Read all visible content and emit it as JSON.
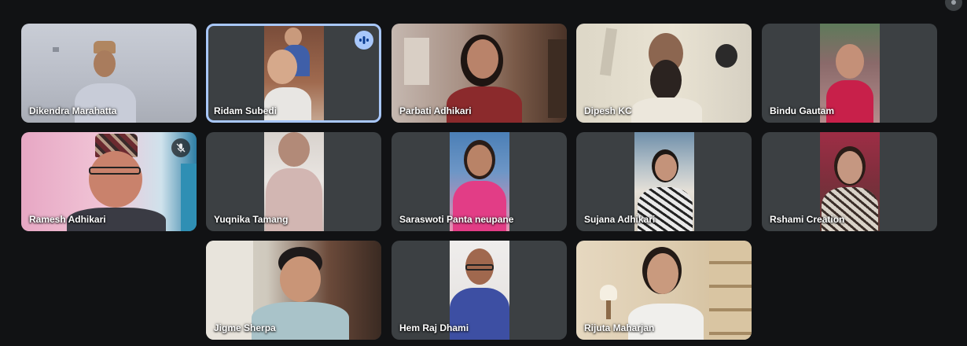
{
  "participants": [
    {
      "name": "Dikendra Marahatta"
    },
    {
      "name": "Ridam Subedi"
    },
    {
      "name": "Parbati Adhikari"
    },
    {
      "name": "Dipesh KC"
    },
    {
      "name": "Bindu Gautam"
    },
    {
      "name": "Ramesh Adhikari"
    },
    {
      "name": "Yuqnika Tamang"
    },
    {
      "name": "Saraswoti Panta neupane"
    },
    {
      "name": "Sujana Adhikari"
    },
    {
      "name": "Rshami Creation"
    },
    {
      "name": "Jigme Sherpa"
    },
    {
      "name": "Hem Raj Dhami"
    },
    {
      "name": "Rijuta Maharjan"
    }
  ],
  "indicators": {
    "speaking_participant": "Ridam Subedi",
    "muted_participant": "Ramesh Adhikari",
    "audio_icon": "audio-level-icon",
    "muted_icon": "mic-off-icon",
    "top_right_icon": "more-icon"
  },
  "colors": {
    "background": "#111214",
    "tile": "#3c4043",
    "speaking_border": "#a8c7fa"
  }
}
